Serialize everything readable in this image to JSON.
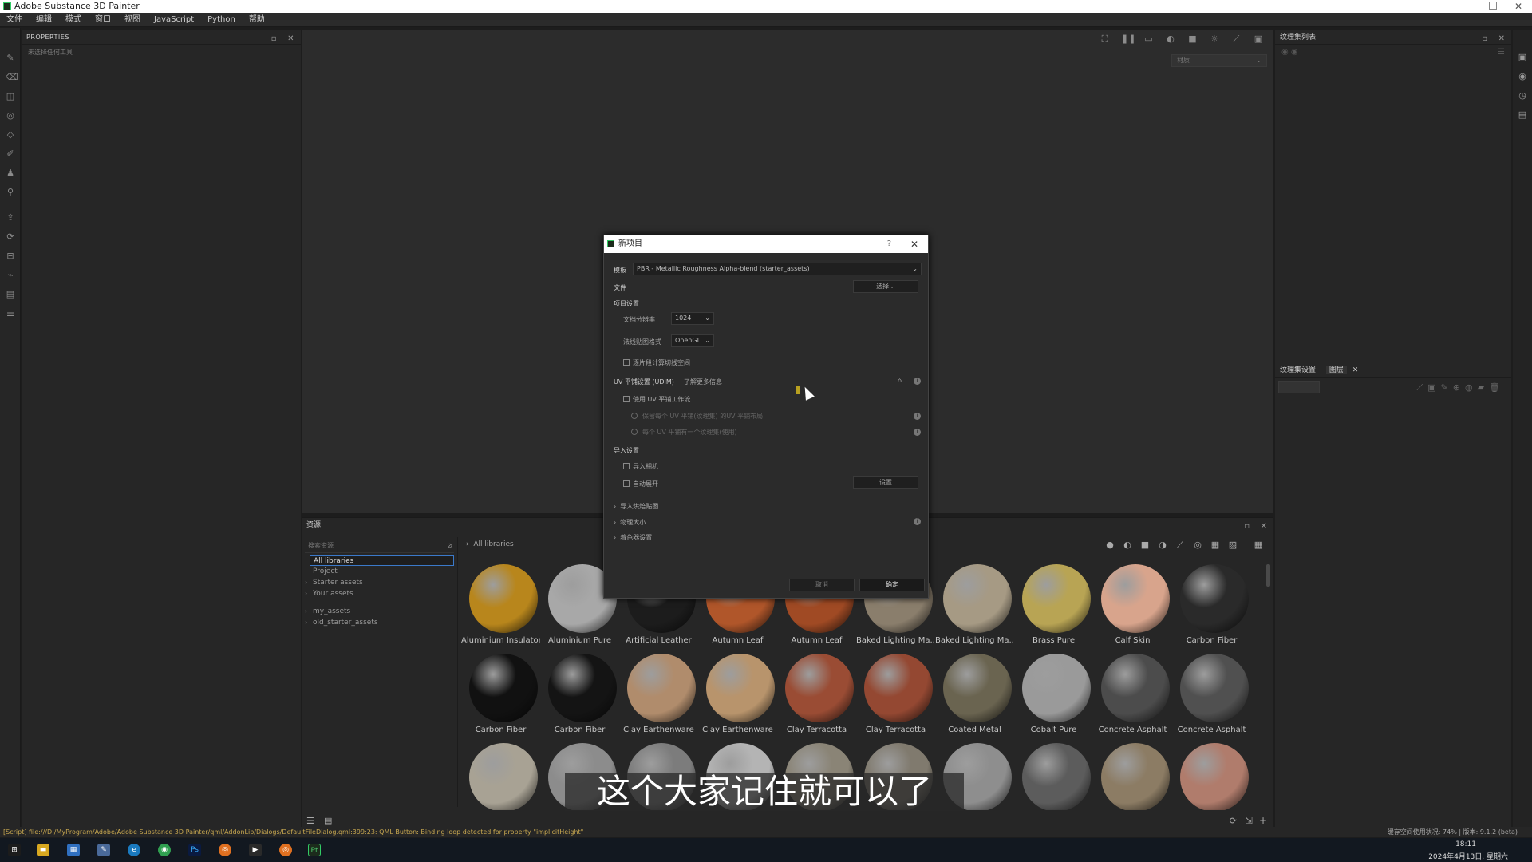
{
  "window": {
    "title": "Adobe Substance 3D Painter"
  },
  "menu": [
    "文件",
    "编辑",
    "模式",
    "窗口",
    "视图",
    "JavaScript",
    "Python",
    "帮助"
  ],
  "properties_panel": {
    "title": "PROPERTIES",
    "hint": "未选择任何工具"
  },
  "viewport": {
    "select_value": "材质"
  },
  "texture_set_panel": {
    "title": "纹理集列表"
  },
  "layers_panel": {
    "tab1": "纹理集设置",
    "tab2": "图层"
  },
  "assets_panel": {
    "title": "资源",
    "search_placeholder": "搜索资源",
    "tree": [
      {
        "label": "All libraries",
        "selected": true
      },
      {
        "label": "Project"
      },
      {
        "label": "Starter assets"
      },
      {
        "label": "Your assets"
      },
      {
        "label": "my_assets"
      },
      {
        "label": "old_starter_assets"
      }
    ],
    "breadcrumb": "All libraries",
    "materials": [
      {
        "name": "Aluminium Insulator",
        "color": "#b8861c"
      },
      {
        "name": "Aluminium Pure",
        "color": "#a8a8a8"
      },
      {
        "name": "Artificial Leather",
        "color": "#1c1c1c"
      },
      {
        "name": "Autumn Leaf",
        "color": "#b0562a"
      },
      {
        "name": "Autumn Leaf",
        "color": "#a04a24"
      },
      {
        "name": "Baked Lighting Ma...",
        "color": "#8a7e6c"
      },
      {
        "name": "Baked Lighting Ma...",
        "color": "#a69a84"
      },
      {
        "name": "Brass Pure",
        "color": "#b8a454"
      },
      {
        "name": "Calf Skin",
        "color": "#d8a48c"
      },
      {
        "name": "Carbon Fiber",
        "color": "#2a2a2a"
      },
      {
        "name": "Carbon Fiber",
        "color": "#111111"
      },
      {
        "name": "Carbon Fiber",
        "color": "#141414"
      },
      {
        "name": "Clay Earthenware",
        "color": "#b08c6c"
      },
      {
        "name": "Clay Earthenware",
        "color": "#b8946c"
      },
      {
        "name": "Clay Terracotta",
        "color": "#9a4c34"
      },
      {
        "name": "Clay Terracotta",
        "color": "#944832"
      },
      {
        "name": "Coated Metal",
        "color": "#6a6450"
      },
      {
        "name": "Cobalt Pure",
        "color": "#9a9a9a"
      },
      {
        "name": "Concrete Asphalt",
        "color": "#4c4c4c"
      },
      {
        "name": "Concrete Asphalt",
        "color": "#505050"
      },
      {
        "name": "",
        "color": "#a8a294"
      },
      {
        "name": "",
        "color": "#8c8c8c"
      },
      {
        "name": "",
        "color": "#7c7c7c"
      },
      {
        "name": "",
        "color": "#b4b4b4"
      },
      {
        "name": "",
        "color": "#8a8476"
      },
      {
        "name": "",
        "color": "#807a6e"
      },
      {
        "name": "",
        "color": "#8e8e8e"
      },
      {
        "name": "",
        "color": "#5c5c5c"
      },
      {
        "name": "",
        "color": "#8c7c64"
      },
      {
        "name": "",
        "color": "#b07c6c"
      }
    ]
  },
  "dialog": {
    "title": "新项目",
    "help": "?",
    "template_label": "模板",
    "template_value": "PBR - Metallic Roughness Alpha-blend (starter_assets)",
    "file_label": "文件",
    "file_button": "选择...",
    "project_settings": "项目设置",
    "doc_resolution_label": "文档分辨率",
    "doc_resolution_value": "1024",
    "normal_format_label": "法线贴图格式",
    "normal_format_value": "OpenGL",
    "tangent_label": "逐片段计算切线空间",
    "uv_label": "UV 平铺设置 (UDIM)",
    "uv_learn_more": "了解更多信息",
    "uv_check": "使用 UV 平铺工作流",
    "uv_option1": "保留每个 UV 平铺(纹理集) 的UV 平铺布局",
    "uv_option2": "每个 UV 平铺有一个纹理集(使用)",
    "import_settings": "导入设置",
    "import_cameras": "导入相机",
    "auto_unwrap": "自动展开",
    "settings_button": "设置",
    "import_baked": "导入烘焙贴图",
    "physical_size": "物理大小",
    "shader_settings": "着色器设置",
    "cancel": "取消",
    "ok": "确定"
  },
  "status_bar": {
    "message": "[Script] file:///D:/MyProgram/Adobe/Adobe Substance 3D Painter/qml/AddonLib/Dialogs/DefaultFileDialog.qml:399:23: QML Button: Binding loop detected for property \"implicitHeight\"",
    "right": "缓存空间使用状况: 74% | 版本: 9.1.2 (beta)"
  },
  "taskbar": {
    "time": "18:11",
    "date": "2024年4月13日, 星期六"
  },
  "subtitle": "这个大家记住就可以了"
}
